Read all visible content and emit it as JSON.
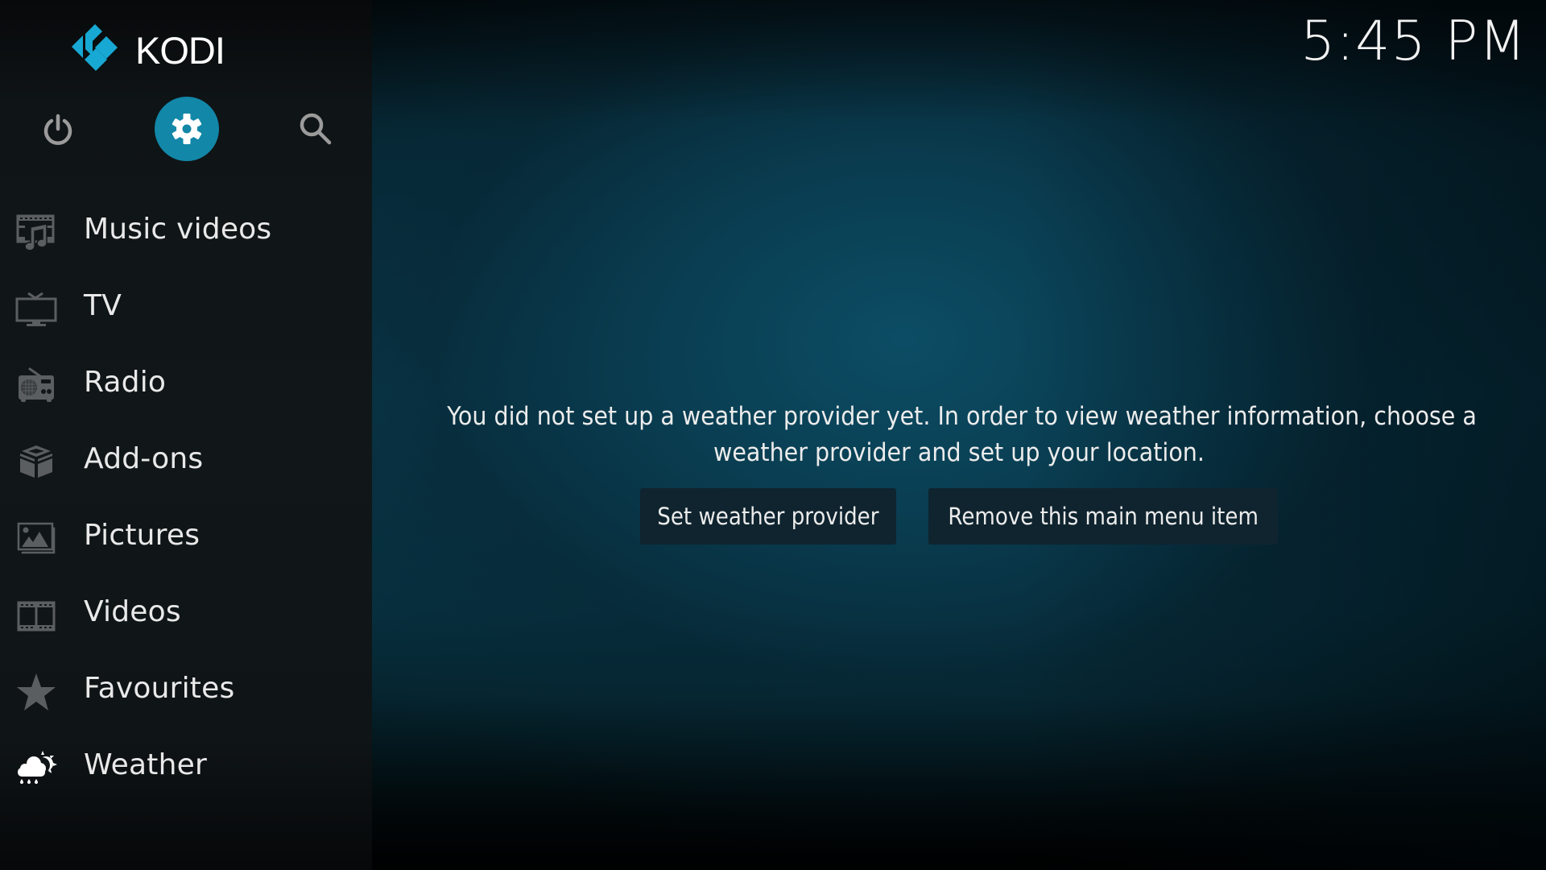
{
  "app": {
    "name": "KODI",
    "clock": "5:45 PM",
    "accent_color": "#1287a8"
  },
  "top_controls": [
    {
      "name": "power",
      "icon": "power-icon"
    },
    {
      "name": "settings",
      "icon": "gear-icon",
      "active": true
    },
    {
      "name": "search",
      "icon": "search-icon"
    }
  ],
  "sidebar": {
    "items": [
      {
        "label": "Music videos",
        "icon": "music-video-icon"
      },
      {
        "label": "TV",
        "icon": "tv-icon"
      },
      {
        "label": "Radio",
        "icon": "radio-icon"
      },
      {
        "label": "Add-ons",
        "icon": "addons-box-icon"
      },
      {
        "label": "Pictures",
        "icon": "pictures-icon"
      },
      {
        "label": "Videos",
        "icon": "film-strip-icon"
      },
      {
        "label": "Favourites",
        "icon": "star-icon"
      },
      {
        "label": "Weather",
        "icon": "weather-icon",
        "selected": true
      }
    ]
  },
  "weather_panel": {
    "message_line1": "You did not set up a weather provider yet. In order to view weather information, choose a",
    "message_line2": "weather provider and set up your location.",
    "buttons": {
      "set_provider": "Set weather provider",
      "remove_item": "Remove this main menu item"
    }
  }
}
